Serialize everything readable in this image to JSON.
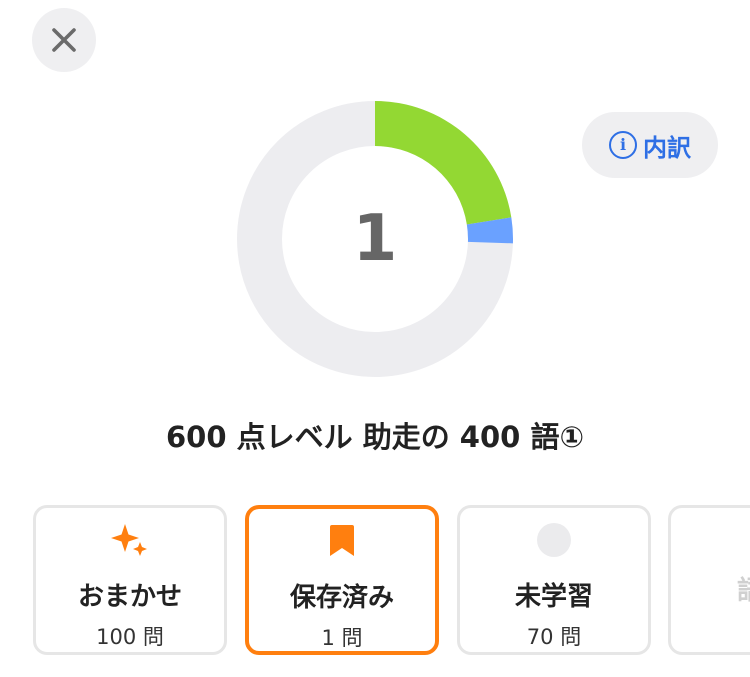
{
  "header": {
    "close_icon": "close-icon",
    "breakdown": {
      "label": "内訳",
      "icon": "info-icon"
    }
  },
  "progress": {
    "center_value": "1",
    "colors": {
      "track": "#ededf0",
      "learned": "#93d833",
      "saved": "#6aa1ff"
    },
    "segments": [
      {
        "name": "learned",
        "fraction": 0.225
      },
      {
        "name": "saved",
        "fraction": 0.03
      }
    ]
  },
  "set_title": "600 点レベル 助走の 400 語①",
  "modes": [
    {
      "title": "おまかせ",
      "count": "100 問",
      "icon": "sparkle-icon",
      "color": "#ff7f0f",
      "selected": false
    },
    {
      "title": "保存済み",
      "count": "1 問",
      "icon": "bookmark-icon",
      "color": "#ff7f0f",
      "selected": true
    },
    {
      "title": "未学習",
      "count": "70 問",
      "icon": "circle-icon",
      "color": "#ebebed",
      "selected": false
    }
  ],
  "partial_card": {
    "glyph": "語"
  }
}
